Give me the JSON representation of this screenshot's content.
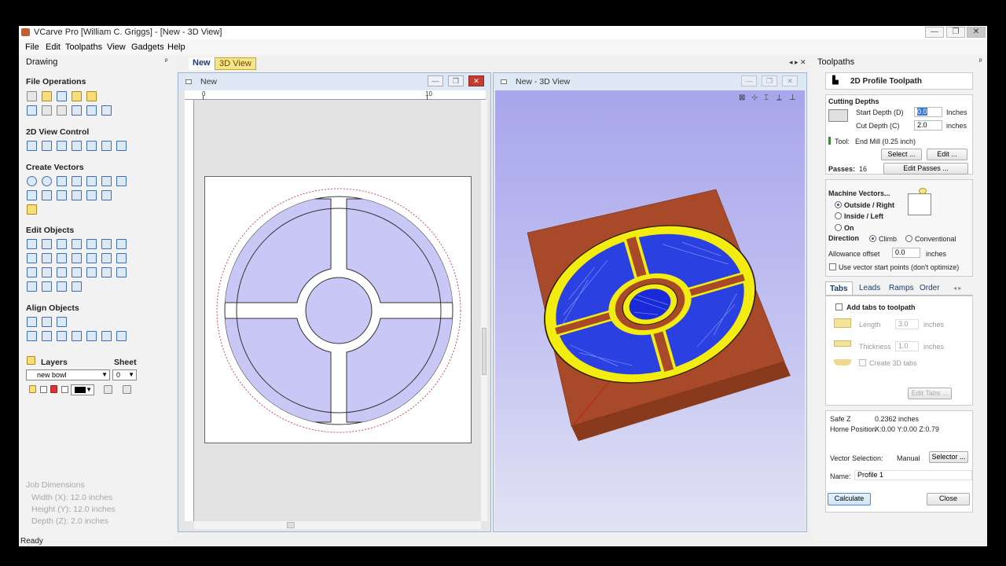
{
  "window": {
    "title": "VCarve Pro [William C. Griggs] - [New - 3D View]",
    "minimize": "—",
    "restore": "❐",
    "close": "✕"
  },
  "menu": [
    "File",
    "Edit",
    "Toolpaths",
    "View",
    "Gadgets",
    "Help"
  ],
  "left_panel": {
    "header": "Drawing",
    "pin": "ᵖ",
    "sections": {
      "file_ops": "File Operations",
      "view_control": "2D View Control",
      "create_vectors": "Create Vectors",
      "edit_objects": "Edit Objects",
      "align_objects": "Align Objects"
    },
    "layers_label": "Layers",
    "sheet_label": "Sheet",
    "layer_value": "new bowl",
    "sheet_value": "0",
    "job_dimensions": {
      "title": "Job Dimensions",
      "width": "Width  (X): 12.0 inches",
      "height": "Height (Y): 12.0 inches",
      "depth": "Depth  (Z): 2.0 inches"
    }
  },
  "view_tabs": [
    "New",
    "3D View"
  ],
  "view_tab_nav": "◂ ▸ ✕",
  "view2d": {
    "title": "New",
    "ruler_0": "0",
    "ruler_10": "10"
  },
  "view3d": {
    "title": "New - 3D View"
  },
  "right_panel": {
    "header": "Toolpaths",
    "pin": "ᵖ",
    "title": "2D Profile Toolpath",
    "cutting_depths": "Cutting Depths",
    "start_depth_label": "Start Depth (D)",
    "start_depth_value": "0.0",
    "cut_depth_label": "Cut Depth (C)",
    "cut_depth_value": "2.0",
    "units": "inches",
    "units_cap": "Inches",
    "tool_label": "Tool:",
    "tool_value": "End Mill (0.25 inch)",
    "select_btn": "Select ...",
    "edit_btn": "Edit ...",
    "passes_label": "Passes:",
    "passes_value": "16",
    "edit_passes_btn": "Edit Passes ...",
    "machine_vectors": "Machine Vectors...",
    "outside_right": "Outside / Right",
    "inside_left": "Inside / Left",
    "on": "On",
    "direction": "Direction",
    "climb": "Climb",
    "conventional": "Conventional",
    "allowance_label": "Allowance offset",
    "allowance_value": "0.0",
    "use_vector_start": "Use vector start points (don't optimize)",
    "tabs": [
      "Tabs",
      "Leads",
      "Ramps",
      "Order"
    ],
    "tab_nav": "◂ ▸",
    "add_tabs": "Add tabs to toolpath",
    "length_label": "Length",
    "length_value": "3.0",
    "thickness_label": "Thickness",
    "thickness_value": "1.0",
    "create_3d_tabs": "Create 3D tabs",
    "edit_tabs_btn": "Edit Tabs ...",
    "safe_z": "Safe Z",
    "safe_z_value": "0.2362 inches",
    "home_position": "Home Position",
    "home_value": "X:0.00 Y:0.00 Z:0.79",
    "vector_selection": "Vector Selection:",
    "vector_selection_value": "Manual",
    "selector_btn": "Selector ...",
    "name_label": "Name:",
    "name_value": "Profile 1",
    "calculate_btn": "Calculate",
    "close_btn": "Close"
  },
  "status": "Ready",
  "colors": {
    "pocket_fill": "#c9c7f6",
    "wood": "#a84a2a",
    "carve_blue": "#1a2ad8",
    "carve_yellow": "#f2ec10",
    "sky_top": "#a8a6ec"
  }
}
